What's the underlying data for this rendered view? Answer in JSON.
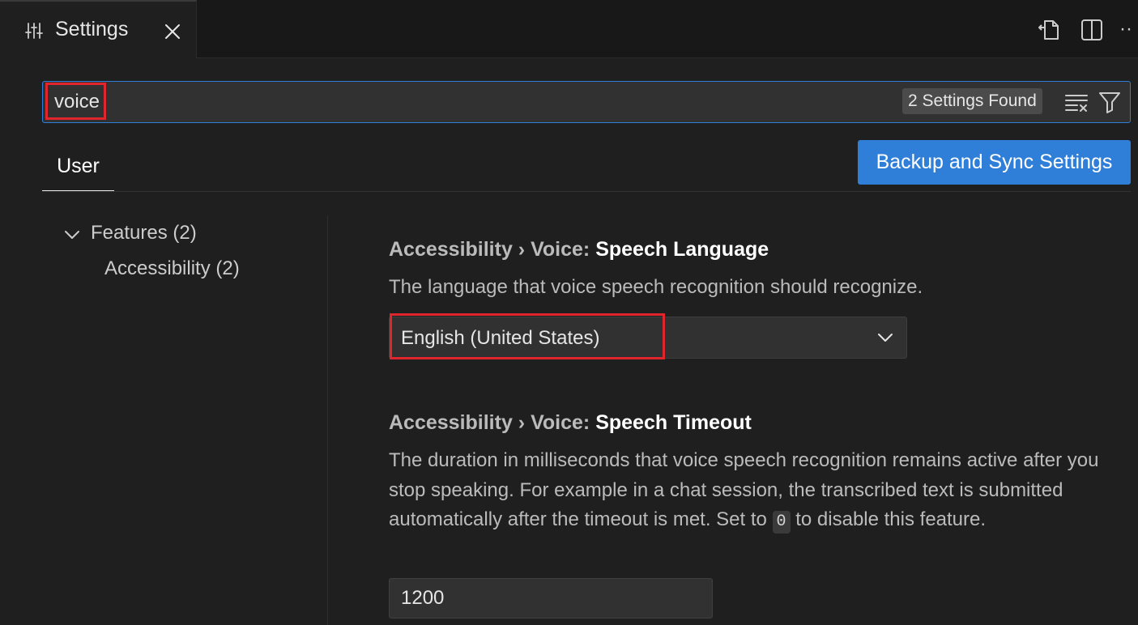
{
  "tab": {
    "title": "Settings",
    "icon": "settings-sliders-icon",
    "close_icon": "close-icon"
  },
  "toolbar": {
    "open_json_icon": "open-settings-json-icon",
    "split_icon": "split-editor-icon",
    "more_label": "··"
  },
  "search": {
    "value": "voice",
    "results_badge": "2 Settings Found",
    "clear_icon": "clear-filter-icon",
    "filter_icon": "filter-icon"
  },
  "scope_tabs": [
    {
      "label": "User",
      "active": true
    }
  ],
  "sync_button": "Backup and Sync Settings",
  "toc": {
    "group": "Features (2)",
    "item": "Accessibility (2)"
  },
  "settings": [
    {
      "category": "Accessibility › Voice: ",
      "name": "Speech Language",
      "description": "The language that voice speech recognition should recognize.",
      "type": "select",
      "value": "English (United States)"
    },
    {
      "category": "Accessibility › Voice: ",
      "name": "Speech Timeout",
      "description_before": "The duration in milliseconds that voice speech recognition remains active after you stop speaking. For example in a chat session, the transcribed text is submitted automatically after the timeout is met. Set to ",
      "description_code": "0",
      "description_after": " to disable this feature.",
      "type": "number",
      "value": "1200"
    }
  ],
  "colors": {
    "accent": "#2f7ed8",
    "highlight_box": "#e0262c",
    "background": "#1f1f1f"
  }
}
